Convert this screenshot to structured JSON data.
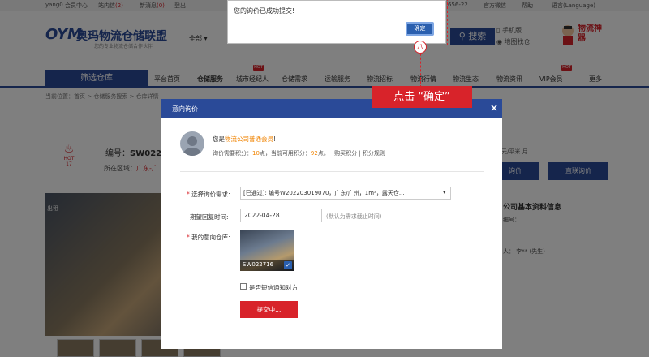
{
  "topbar": {
    "user": "yang0",
    "member_center": "会员中心",
    "inbox_label": "站内信",
    "inbox_count": "(2)",
    "notify_label": "新消息",
    "notify_count": "(0)",
    "logout": "登出",
    "phone_fragment": "656-22",
    "wechat": "官方微信",
    "help": "帮助",
    "language": "语言(Language)"
  },
  "header": {
    "logo_mark": "OYM",
    "logo_text": "奥玛物流仓储联盟",
    "slogan": "您的专业物流仓储合作伙伴",
    "region": "全部 ▾",
    "search_button": "搜索",
    "mobile": "手机版",
    "map": "地图找仓",
    "tool_label": "物流神器"
  },
  "nav": {
    "filter": "筛选仓库",
    "items": [
      "平台首页",
      "仓储服务",
      "城市经纪人",
      "仓储需求",
      "运输服务",
      "物流招标",
      "物流行情",
      "物流生态",
      "物流资讯",
      "VIP会员",
      "更多"
    ],
    "hot_badge": "HOT"
  },
  "breadcrumb": "当前位置：首页 > 仓储服务搜索 > 仓库详情",
  "page": {
    "hot_label": "HOT",
    "hot_count": "17",
    "code_prefix": "编号：",
    "code": "SW0227",
    "region_label": "所在区域：",
    "region_value": "广东-广",
    "photo_label": "出租",
    "price_unit": "元/平米 月",
    "btn_inquiry": "询价",
    "btn_direct": "直联询价",
    "info_title": "公司基本资料信息",
    "info_code": "编号：",
    "info_contact": "人：  李** (先生)"
  },
  "alert": {
    "message": "您的询价已成功提交!",
    "ok": "确定",
    "step": "八",
    "tip": "点击 “确定”"
  },
  "dialog": {
    "title": "意向询价",
    "close": "×",
    "greeting_prefix": "您是",
    "greeting_member": "物流公司普通会员",
    "greeting_suffix": "!",
    "points_label": "询价需要积分：",
    "points_need": "10",
    "points_mid": "点，当前可用积分：",
    "points_avail": "92",
    "points_suffix": "点。",
    "buy_points": "购买积分",
    "sep": "|",
    "points_rules": "积分规则",
    "req_mark": "*",
    "select_demand_label": "选择询价需求:",
    "demand_value": "[已通过]: 编号W202203019070，广东/广州，1m²，露天仓...",
    "date_label": "期望回复时间:",
    "date_value": "2022-04-28",
    "date_hint": "(默认为需求截止时间)",
    "warehouse_label": "我的意向仓库:",
    "warehouse_code": "SW022716",
    "sms_label": "是否短信通知对方",
    "submit": "提交中..."
  },
  "colors": {
    "brand_blue": "#2a4a98",
    "accent_red": "#d8232a",
    "highlight_orange": "#f08300"
  }
}
